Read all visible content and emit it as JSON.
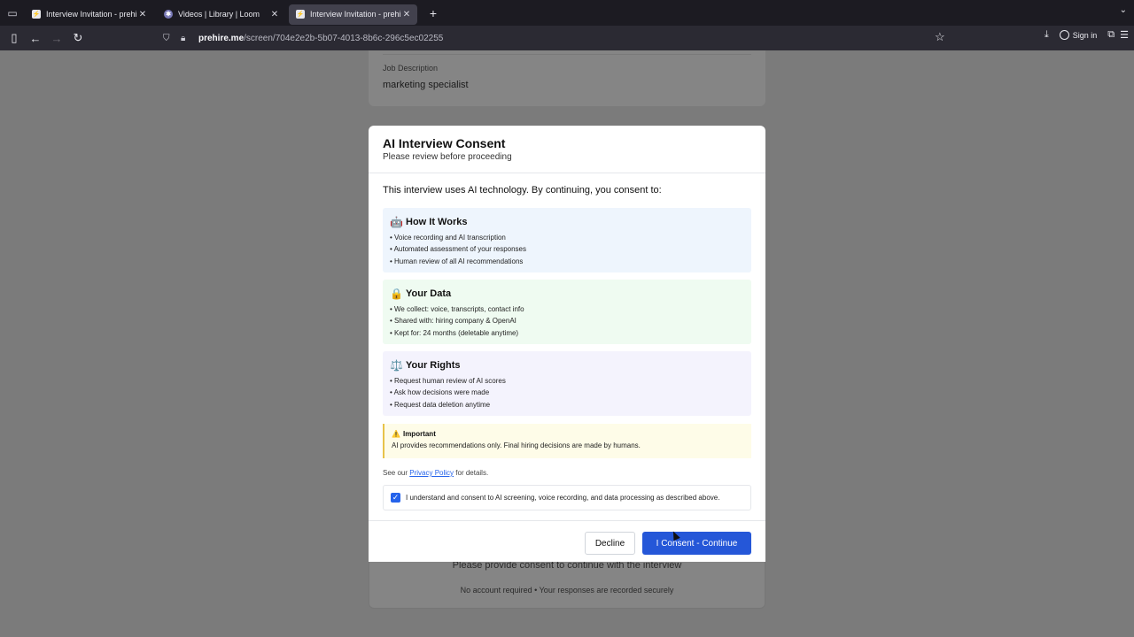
{
  "browser": {
    "tabs": [
      {
        "title": "Interview Invitation - prehire.me",
        "active": false
      },
      {
        "title": "Videos | Library | Loom",
        "active": false
      },
      {
        "title": "Interview Invitation - prehire.me",
        "active": true
      }
    ],
    "url_host": "prehire.me",
    "url_path": "/screen/704e2e2b-5b07-4013-8b6c-296c5ec02255",
    "sign_in": "Sign in"
  },
  "background": {
    "job_label": "Job Description",
    "job_value": "marketing specialist",
    "bottom_message": "Please provide consent to continue with the interview",
    "bottom_note": "No account required • Your responses are recorded securely"
  },
  "modal": {
    "title": "AI Interview Consent",
    "subtitle": "Please review before proceeding",
    "intro": "This interview uses AI technology. By continuing, you consent to:",
    "how": {
      "title": "How It Works",
      "icon": "🤖",
      "items": [
        "• Voice recording and AI transcription",
        "• Automated assessment of your responses",
        "• Human review of all AI recommendations"
      ]
    },
    "data": {
      "title": "Your Data",
      "icon": "🔒",
      "items": [
        "• We collect: voice, transcripts, contact info",
        "• Shared with: hiring company & OpenAI",
        "• Kept for: 24 months (deletable anytime)"
      ]
    },
    "rights": {
      "title": "Your Rights",
      "icon": "⚖️",
      "items": [
        "• Request human review of AI scores",
        "• Ask how decisions were made",
        "• Request data deletion anytime"
      ]
    },
    "important": {
      "icon": "⚠️",
      "title": "Important",
      "text": "AI provides recommendations only. Final hiring decisions are made by humans."
    },
    "privacy": {
      "prefix": "See our ",
      "link": "Privacy Policy",
      "suffix": " for details."
    },
    "consent_checkbox": {
      "checked": true,
      "label": "I understand and consent to AI screening, voice recording, and data processing as described above."
    },
    "decline_label": "Decline",
    "consent_label": "I Consent - Continue"
  }
}
